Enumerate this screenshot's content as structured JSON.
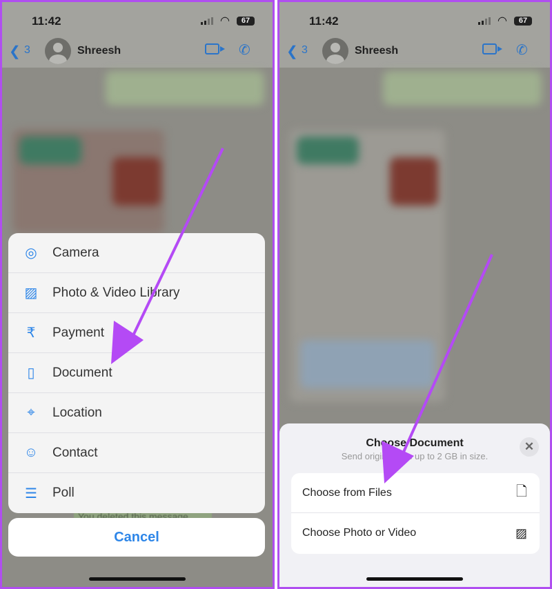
{
  "status": {
    "time": "11:42",
    "battery": "67"
  },
  "chat": {
    "back_count": "3",
    "contact": "Shreesh",
    "deleted_message": "You deleted this message"
  },
  "attach_menu": {
    "items": [
      {
        "label": "Camera",
        "icon": "camera-icon"
      },
      {
        "label": "Photo & Video Library",
        "icon": "photo-icon"
      },
      {
        "label": "Payment",
        "icon": "rupee-icon"
      },
      {
        "label": "Document",
        "icon": "document-icon"
      },
      {
        "label": "Location",
        "icon": "location-pin-icon"
      },
      {
        "label": "Contact",
        "icon": "contact-icon"
      },
      {
        "label": "Poll",
        "icon": "poll-icon"
      }
    ],
    "cancel": "Cancel"
  },
  "document_sheet": {
    "title": "Choose Document",
    "subtitle": "Send original files up to 2 GB in size.",
    "close": "✕",
    "options": [
      {
        "label": "Choose from Files",
        "icon": "file-icon"
      },
      {
        "label": "Choose Photo or Video",
        "icon": "photos-icon"
      }
    ]
  },
  "colors": {
    "accent": "#2e86e8",
    "annotation_arrow": "#b44af5",
    "border": "#b04ef0"
  }
}
